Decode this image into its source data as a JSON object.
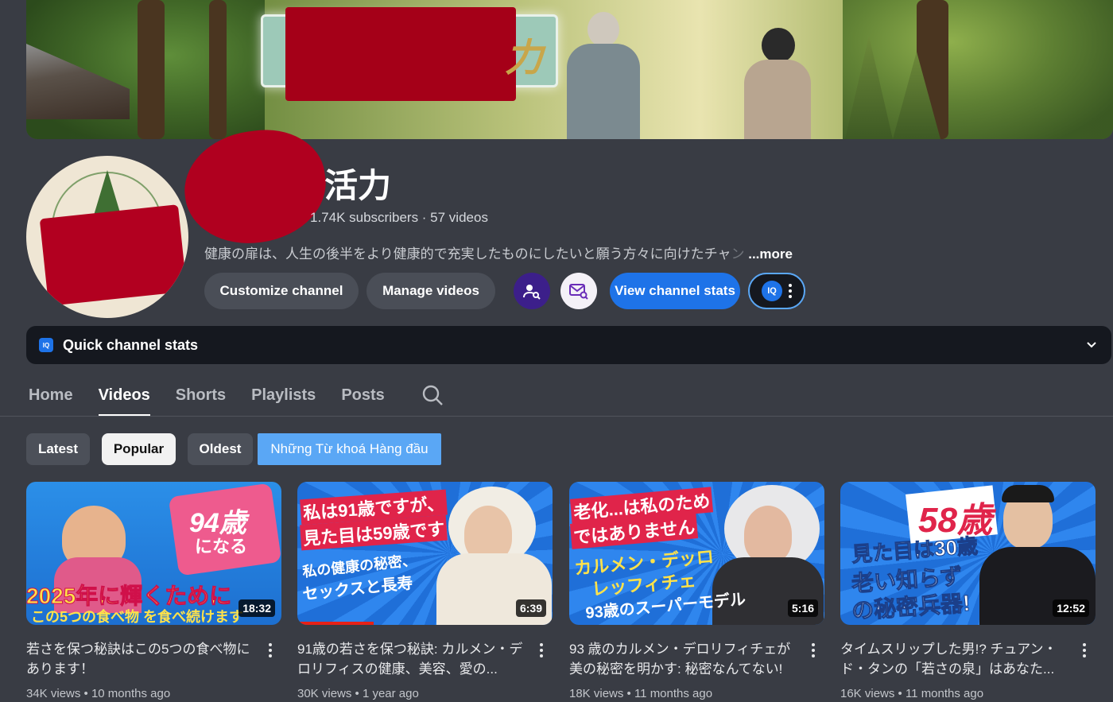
{
  "banner": {
    "sign_text": "力"
  },
  "channel": {
    "name": "活力",
    "meta": "1.74K subscribers · 57 videos",
    "description": "健康の扉は、人生の後半をより健康的で充実したものにしたいと願う方々に向けたチャ",
    "description_fade": "ン",
    "more_label": "...more"
  },
  "actions": {
    "customize": "Customize channel",
    "manage": "Manage videos",
    "view_stats": "View channel stats",
    "iq_label": "IQ"
  },
  "quick_stats": {
    "label": "Quick channel stats"
  },
  "tabs": [
    {
      "label": "Home"
    },
    {
      "label": "Videos"
    },
    {
      "label": "Shorts"
    },
    {
      "label": "Playlists"
    },
    {
      "label": "Posts"
    }
  ],
  "chips": [
    {
      "label": "Latest"
    },
    {
      "label": "Popular"
    },
    {
      "label": "Oldest"
    },
    {
      "label": "Những Từ khoá Hàng đầu"
    }
  ],
  "videos": [
    {
      "title": "若さを保つ秘訣はこの5つの食べ物にあります！",
      "meta": "34K views • 10 months ago",
      "duration": "18:32",
      "thumb_line1": "94歳",
      "thumb_line2": "になる",
      "thumb_line3": "2025年に輝くために",
      "thumb_line4": "この5つの食べ物 を食べ続けます"
    },
    {
      "title": "91歳の若さを保つ秘訣: カルメン・デロリフィスの健康、美容、愛の...",
      "meta": "30K views • 1 year ago",
      "duration": "6:39",
      "progress": 0.3,
      "thumb_line1": "私は91歳ですが、",
      "thumb_line2": "見た目は59歳です",
      "thumb_line3": "私の健康の秘密、",
      "thumb_line4": "セックスと長寿"
    },
    {
      "title": "93 歳のカルメン・デロリフィチェが美の秘密を明かす: 秘密なんてない!",
      "meta": "18K views • 11 months ago",
      "duration": "5:16",
      "thumb_line1": "老化...は私のため",
      "thumb_line2": "ではありません",
      "thumb_line3": "カルメン・デッロ",
      "thumb_line4": "レッフィチェ",
      "thumb_line5": "93歳のスーパーモデル"
    },
    {
      "title": "タイムスリップした男!? チュアン・ド・タンの「若さの泉」はあなた...",
      "meta": "16K views • 11 months ago",
      "duration": "12:52",
      "thumb_line1": "58歳",
      "thumb_line2": "見た目は30歳",
      "thumb_line3": "老い知らず",
      "thumb_line4": "の秘密兵器!"
    }
  ],
  "colors": {
    "background": "#393c44",
    "accent": "#1e73e8",
    "redaction": "#a50018"
  }
}
